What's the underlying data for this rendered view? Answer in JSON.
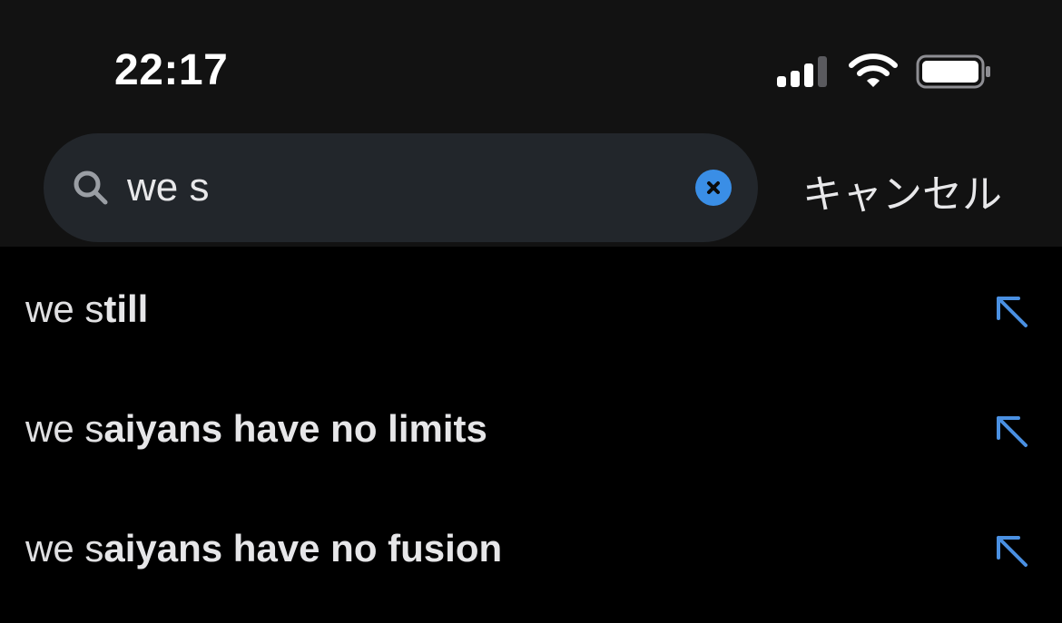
{
  "status_bar": {
    "time": "22:17",
    "icons": [
      "cellular-signal-icon",
      "wifi-icon",
      "battery-icon"
    ]
  },
  "search": {
    "value": "we s",
    "placeholder": "",
    "cancel_label": "キャンセル"
  },
  "suggestions": [
    {
      "prefix": "we s",
      "completion": "till"
    },
    {
      "prefix": "we s",
      "completion": "aiyans have no limits"
    },
    {
      "prefix": "we s",
      "completion": "aiyans have no fusion"
    }
  ],
  "colors": {
    "background": "#000000",
    "header_background": "#121212",
    "search_field": "#22262b",
    "accent": "#3a8ee6",
    "arrow": "#4a90e2"
  }
}
